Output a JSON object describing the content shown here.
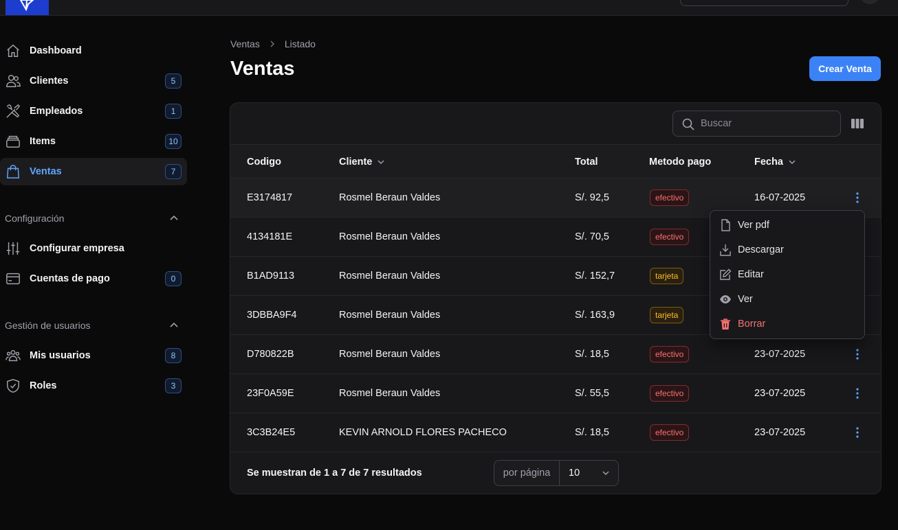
{
  "sidebar": {
    "items": [
      {
        "label": "Dashboard",
        "badge": null
      },
      {
        "label": "Clientes",
        "badge": "5"
      },
      {
        "label": "Empleados",
        "badge": "1"
      },
      {
        "label": "Items",
        "badge": "10"
      },
      {
        "label": "Ventas",
        "badge": "7"
      }
    ],
    "groups": [
      {
        "title": "Configuración",
        "items": [
          {
            "label": "Configurar empresa",
            "badge": null
          },
          {
            "label": "Cuentas de pago",
            "badge": "0"
          }
        ]
      },
      {
        "title": "Gestión de usuarios",
        "items": [
          {
            "label": "Mis usuarios",
            "badge": "8"
          },
          {
            "label": "Roles",
            "badge": "3"
          }
        ]
      }
    ]
  },
  "breadcrumb": [
    "Ventas",
    "Listado"
  ],
  "page_title": "Ventas",
  "create_button": "Crear Venta",
  "search": {
    "placeholder": "Buscar"
  },
  "table": {
    "columns": [
      "Codigo",
      "Cliente",
      "Total",
      "Metodo pago",
      "Fecha"
    ],
    "rows": [
      {
        "codigo": "E3174817",
        "cliente": "Rosmel Beraun Valdes",
        "total": "S/. 92,5",
        "metodo": "efectivo",
        "fecha": "16-07-2025"
      },
      {
        "codigo": "4134181E",
        "cliente": "Rosmel Beraun Valdes",
        "total": "S/. 70,5",
        "metodo": "efectivo",
        "fecha": ""
      },
      {
        "codigo": "B1AD9113",
        "cliente": "Rosmel Beraun Valdes",
        "total": "S/. 152,7",
        "metodo": "tarjeta",
        "fecha": ""
      },
      {
        "codigo": "3DBBA9F4",
        "cliente": "Rosmel Beraun Valdes",
        "total": "S/. 163,9",
        "metodo": "tarjeta",
        "fecha": ""
      },
      {
        "codigo": "D780822B",
        "cliente": "Rosmel Beraun Valdes",
        "total": "S/. 18,5",
        "metodo": "efectivo",
        "fecha": "23-07-2025"
      },
      {
        "codigo": "23F0A59E",
        "cliente": "Rosmel Beraun Valdes",
        "total": "S/. 55,5",
        "metodo": "efectivo",
        "fecha": "23-07-2025"
      },
      {
        "codigo": "3C3B24E5",
        "cliente": "KEVIN ARNOLD FLORES PACHECO",
        "total": "S/. 18,5",
        "metodo": "efectivo",
        "fecha": "23-07-2025"
      }
    ]
  },
  "row_menu": {
    "items": [
      {
        "label": "Ver pdf",
        "icon": "file-icon"
      },
      {
        "label": "Descargar",
        "icon": "download-icon"
      },
      {
        "label": "Editar",
        "icon": "edit-icon"
      },
      {
        "label": "Ver",
        "icon": "eye-icon"
      },
      {
        "label": "Borrar",
        "icon": "trash-icon"
      }
    ]
  },
  "footer": {
    "summary": "Se muestran de 1 a 7 de 7 resultados",
    "per_page_label": "por página",
    "per_page_value": "10"
  },
  "colors": {
    "accent": "#3b82f6",
    "danger": "#f87171",
    "warning": "#fbbf24",
    "background": "#0a0a0b",
    "surface": "#18181b"
  }
}
